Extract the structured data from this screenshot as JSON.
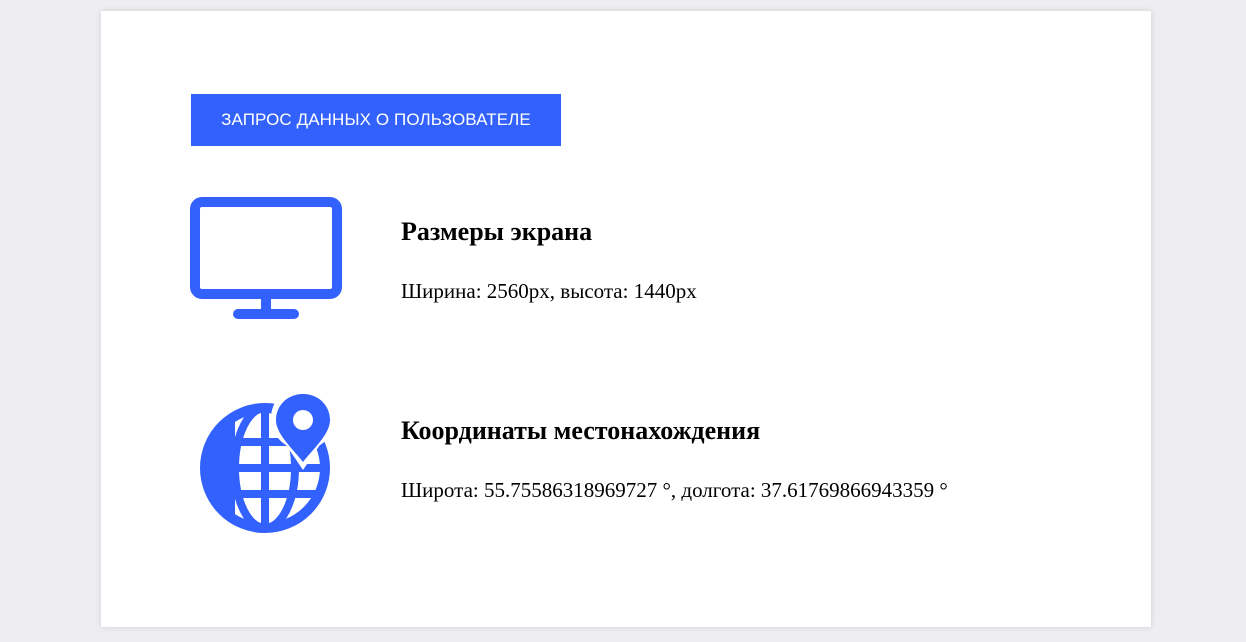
{
  "button": {
    "label": "ЗАПРОС ДАННЫХ О ПОЛЬЗОВАТЕЛЕ"
  },
  "screen": {
    "icon": "monitor-icon",
    "title": "Размеры экрана",
    "text": "Ширина: 2560px, высота: 1440px"
  },
  "location": {
    "icon": "globe-location-icon",
    "title": "Координаты местонахождения",
    "text": "Широта: 55.75586318969727 °, долгота: 37.61769866943359 °"
  },
  "colors": {
    "accent": "#3361fe",
    "background": "#eeeef1",
    "card": "#ffffff"
  }
}
